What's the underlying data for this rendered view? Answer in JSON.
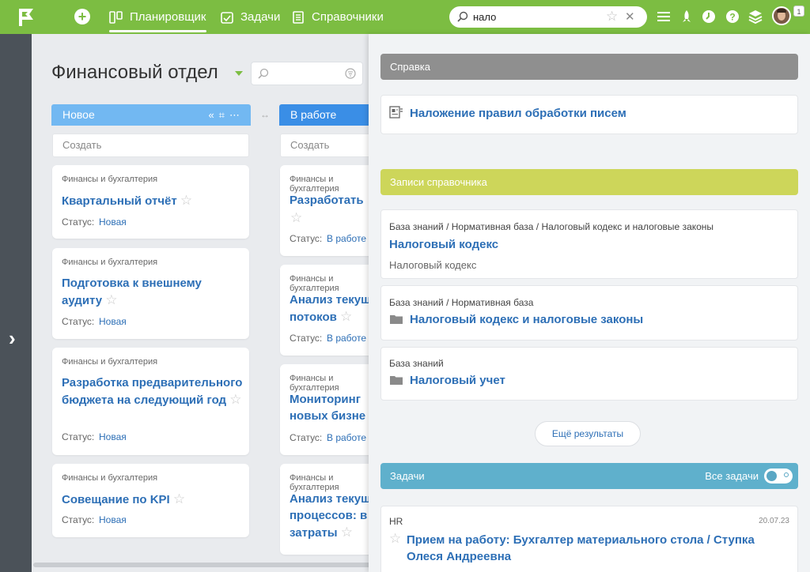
{
  "nav": {
    "planner": "Планировщик",
    "tasks": "Задачи",
    "directories": "Справочники"
  },
  "search": {
    "query": "нало"
  },
  "user": {
    "notification_count": "1"
  },
  "board": {
    "title": "Финансовый отдел",
    "columns": [
      {
        "title": "Новое",
        "create": "Создать",
        "color": "#72b8f2"
      },
      {
        "title": "В работе",
        "create": "Создать",
        "color": "#3a8ee6"
      }
    ],
    "status_label": "Статус:",
    "cards_new": [
      {
        "category": "Финансы и бухгалтерия",
        "title": "Квартальный отчёт",
        "status": "Новая"
      },
      {
        "category": "Финансы и бухгалтерия",
        "title": "Подготовка к внешнему аудиту",
        "status": "Новая"
      },
      {
        "category": "Финансы и бухгалтерия",
        "title": "Разработка предварительного бюджета на следующий год",
        "status": "Новая"
      },
      {
        "category": "Финансы и бухгалтерия",
        "title": "Совещание по KPI",
        "status": "Новая"
      }
    ],
    "cards_work": [
      {
        "category": "Финансы и бухгалтерия",
        "title": "Разработать",
        "status": "В работе"
      },
      {
        "category": "Финансы и бухгалтерия",
        "title_l1": "Анализ текущ",
        "title_l2": "потоков",
        "status": "В работе"
      },
      {
        "category": "Финансы и бухгалтерия",
        "title_l1": "Мониторинг",
        "title_l2": "новых бизне",
        "status": "В работе"
      },
      {
        "category": "Финансы и бухгалтерия",
        "title_l1": "Анализ текущ",
        "title_l2": "процессов: в",
        "title_l3": "затраты"
      }
    ]
  },
  "results": {
    "help_header": "Справка",
    "help_item": "Наложение правил обработки писем",
    "dir_header": "Записи справочника",
    "dir_items": [
      {
        "path": "База знаний / Нормативная база / Налоговый кодекс и налоговые законы",
        "title": "Налоговый кодекс",
        "subtitle": "Налоговый кодекс"
      },
      {
        "path": "База знаний / Нормативная база",
        "title": "Налоговый кодекс и налоговые законы"
      },
      {
        "path": "База знаний",
        "title": "Налоговый учет"
      }
    ],
    "more": "Ещё результаты",
    "tasks_header": "Задачи",
    "all_tasks": "Все задачи",
    "task": {
      "category": "HR",
      "date": "20.07.23",
      "title_l1": "Прием на работу: Бухгалтер материального стола / Ступка",
      "title_l2": "Олеся Андреевна"
    },
    "colors": {
      "help": "#8f8f8f",
      "dir": "#cdd65a",
      "tasks": "#5fb0cc"
    }
  }
}
